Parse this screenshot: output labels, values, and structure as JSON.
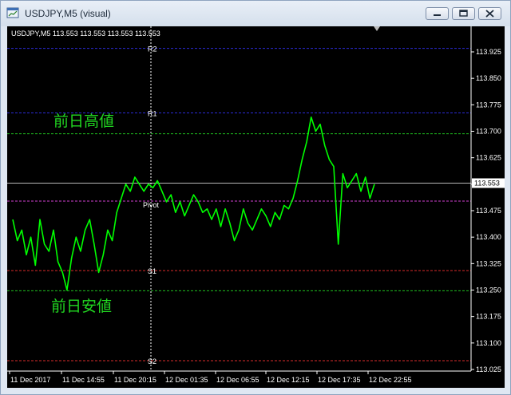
{
  "window": {
    "title": "USDJPY,M5 (visual)",
    "buttons": [
      "minimize",
      "restore",
      "close"
    ]
  },
  "chart_header": "USDJPY,M5  113.553 113.553 113.553 113.553",
  "annotations": {
    "prev_high": "前日高値",
    "prev_low": "前日安値"
  },
  "chart_data": {
    "type": "line",
    "symbol": "USDJPY",
    "timeframe": "M5",
    "ylim": [
      113.025,
      113.97
    ],
    "y_ticks": [
      "113.925",
      "113.850",
      "113.775",
      "113.700",
      "113.625",
      "113.550",
      "113.475",
      "113.400",
      "113.325",
      "113.250",
      "113.175",
      "113.100",
      "113.025"
    ],
    "x_ticks": [
      "11 Dec 2017",
      "11 Dec 14:55",
      "11 Dec 20:15",
      "12 Dec 01:35",
      "12 Dec 06:55",
      "12 Dec 12:15",
      "12 Dec 17:35",
      "12 Dec 22:55"
    ],
    "current_price": "113.553",
    "levels": [
      {
        "name": "R2",
        "value": 113.935,
        "color": "#2b2bd8",
        "labeled": true
      },
      {
        "name": "R1",
        "value": 113.752,
        "color": "#2b2bd8",
        "labeled": true
      },
      {
        "name": "prev_high",
        "value": 113.693,
        "color": "#1fbf1f",
        "labeled": false
      },
      {
        "name": "Pivot",
        "value": 113.502,
        "color": "#d040d0",
        "labeled": true
      },
      {
        "name": "S1",
        "value": 113.305,
        "color": "#d82b2b",
        "labeled": true
      },
      {
        "name": "prev_low",
        "value": 113.248,
        "color": "#1fbf1f",
        "labeled": false
      },
      {
        "name": "S2",
        "value": 113.05,
        "color": "#d82b2b",
        "labeled": true
      }
    ],
    "series": [
      {
        "color": "#00ff00",
        "values": [
          113.45,
          113.39,
          113.42,
          113.35,
          113.4,
          113.32,
          113.45,
          113.38,
          113.36,
          113.42,
          113.33,
          113.3,
          113.25,
          113.34,
          113.4,
          113.36,
          113.42,
          113.45,
          113.38,
          113.3,
          113.35,
          113.42,
          113.39,
          113.47,
          113.51,
          113.55,
          113.53,
          113.57,
          113.55,
          113.53,
          113.55,
          113.54,
          113.56,
          113.53,
          113.5,
          113.52,
          113.47,
          113.5,
          113.46,
          113.49,
          113.52,
          113.5,
          113.47,
          113.48,
          113.45,
          113.48,
          113.43,
          113.48,
          113.44,
          113.39,
          113.42,
          113.48,
          113.44,
          113.42,
          113.45,
          113.48,
          113.46,
          113.43,
          113.47,
          113.45,
          113.49,
          113.48,
          113.51,
          113.56,
          113.62,
          113.67,
          113.74,
          113.7,
          113.72,
          113.66,
          113.62,
          113.6,
          113.38,
          113.58,
          113.54,
          113.56,
          113.58,
          113.53,
          113.57,
          113.51,
          113.55
        ]
      }
    ]
  }
}
